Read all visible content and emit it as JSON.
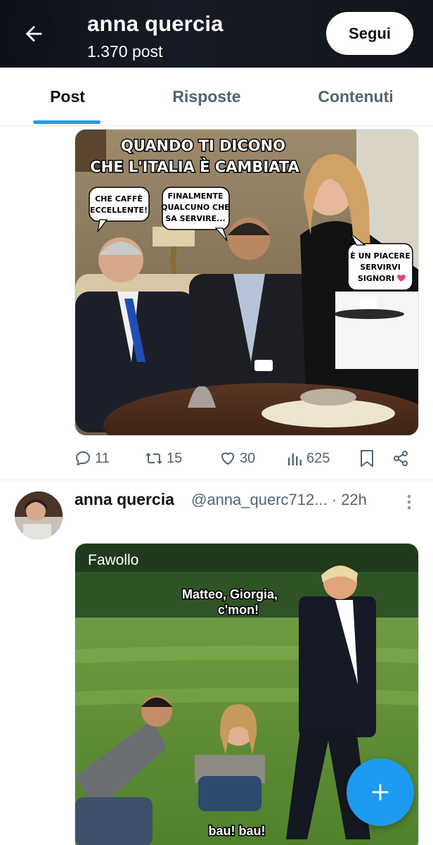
{
  "header": {
    "name": "anna quercia",
    "post_count": "1.370 post",
    "follow_label": "Segui"
  },
  "tabs": [
    {
      "label": "Post",
      "active": true
    },
    {
      "label": "Risposte",
      "active": false
    },
    {
      "label": "Contenuti",
      "active": false
    }
  ],
  "post1": {
    "meme": {
      "title_line1": "QUANDO TI DICONO",
      "title_line2": "CHE L'ITALIA È CAMBIATA",
      "bubble1_line1": "CHE CAFFÈ",
      "bubble1_line2": "ECCELLENTE!",
      "bubble2_line1": "FINALMENTE",
      "bubble2_line2": "QUALCUNO CHE",
      "bubble2_line3": "SA SERVIRE...",
      "bubble3_line1": "È UN PIACERE",
      "bubble3_line2": "SERVIRVI",
      "bubble3_line3": "SIGNORI",
      "bubble3_emoji": "heart"
    },
    "actions": {
      "replies": "11",
      "reposts": "15",
      "likes": "30",
      "views": "625"
    }
  },
  "post2": {
    "name": "anna quercia",
    "handle": "@anna_querc712...",
    "time": "· 22h",
    "meme": {
      "watermark": "Fawollo",
      "caption_line1": "Matteo, Giorgia,",
      "caption_line2": "c'mon!",
      "caption_bottom": "bau! bau!"
    }
  },
  "colors": {
    "accent": "#1d9bf0",
    "text_primary": "#0f1419",
    "text_secondary": "#536471",
    "divider": "#e6e9ec"
  },
  "icons": {
    "back": "arrow-left-icon",
    "reply": "reply-bubble-icon",
    "repost": "repost-icon",
    "like": "heart-icon",
    "views": "bar-chart-icon",
    "bookmark": "bookmark-icon",
    "share": "share-icon",
    "more": "more-vertical-icon",
    "compose": "plus-icon"
  }
}
